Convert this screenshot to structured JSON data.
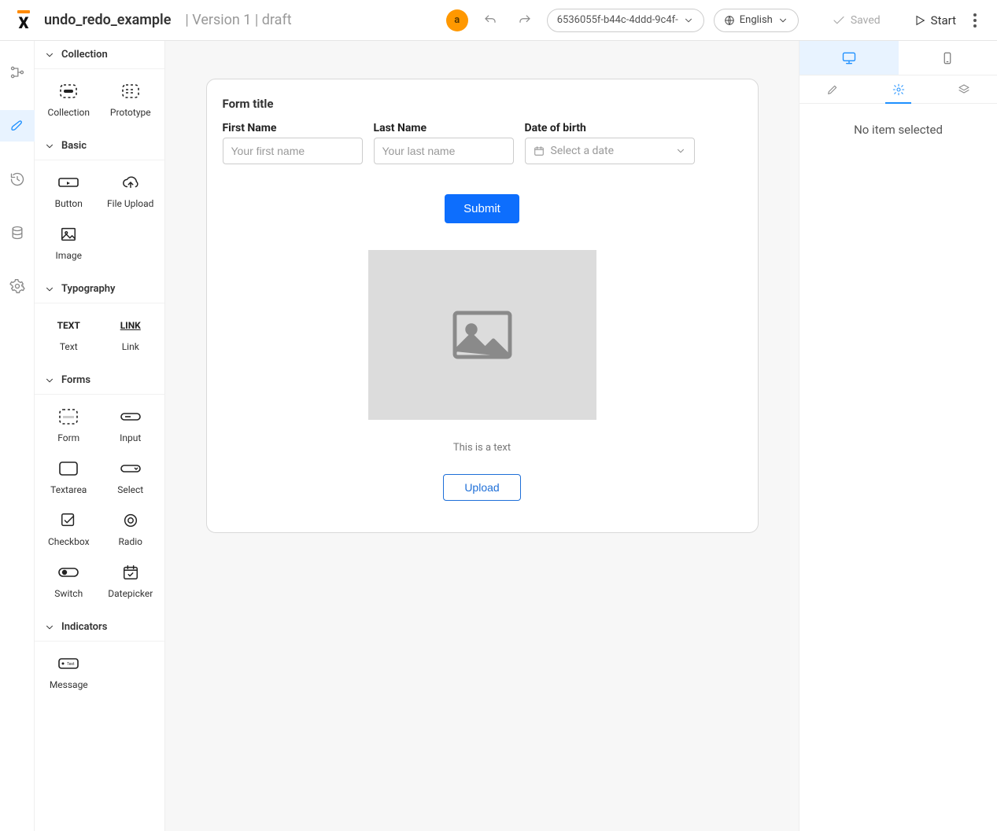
{
  "header": {
    "title": "undo_redo_example",
    "subtitle": "| Version 1 | draft",
    "avatar_initial": "a",
    "id_dropdown": "6536055f-b44c-4ddd-9c4f-",
    "lang_label": "English",
    "saved_label": "Saved",
    "start_label": "Start"
  },
  "palette": {
    "groups": [
      {
        "label": "Collection",
        "items": [
          {
            "label": "Collection",
            "icon": "collection"
          },
          {
            "label": "Prototype",
            "icon": "prototype"
          }
        ]
      },
      {
        "label": "Basic",
        "items": [
          {
            "label": "Button",
            "icon": "button"
          },
          {
            "label": "File Upload",
            "icon": "upload"
          },
          {
            "label": "Image",
            "icon": "image"
          }
        ]
      },
      {
        "label": "Typography",
        "items": [
          {
            "label": "Text",
            "icon": "text"
          },
          {
            "label": "Link",
            "icon": "link"
          }
        ]
      },
      {
        "label": "Forms",
        "items": [
          {
            "label": "Form",
            "icon": "form"
          },
          {
            "label": "Input",
            "icon": "input"
          },
          {
            "label": "Textarea",
            "icon": "textarea"
          },
          {
            "label": "Select",
            "icon": "select"
          },
          {
            "label": "Checkbox",
            "icon": "checkbox"
          },
          {
            "label": "Radio",
            "icon": "radio"
          },
          {
            "label": "Switch",
            "icon": "switch"
          },
          {
            "label": "Datepicker",
            "icon": "datepicker"
          }
        ]
      },
      {
        "label": "Indicators",
        "items": [
          {
            "label": "Message",
            "icon": "message"
          }
        ]
      }
    ]
  },
  "canvas": {
    "form_title": "Form title",
    "first_name": {
      "label": "First Name",
      "placeholder": "Your first name"
    },
    "last_name": {
      "label": "Last Name",
      "placeholder": "Your last name"
    },
    "dob": {
      "label": "Date of birth",
      "placeholder": "Select a date"
    },
    "submit_label": "Submit",
    "sample_text": "This is a text",
    "upload_label": "Upload"
  },
  "rightpanel": {
    "no_selection": "No item selected"
  }
}
